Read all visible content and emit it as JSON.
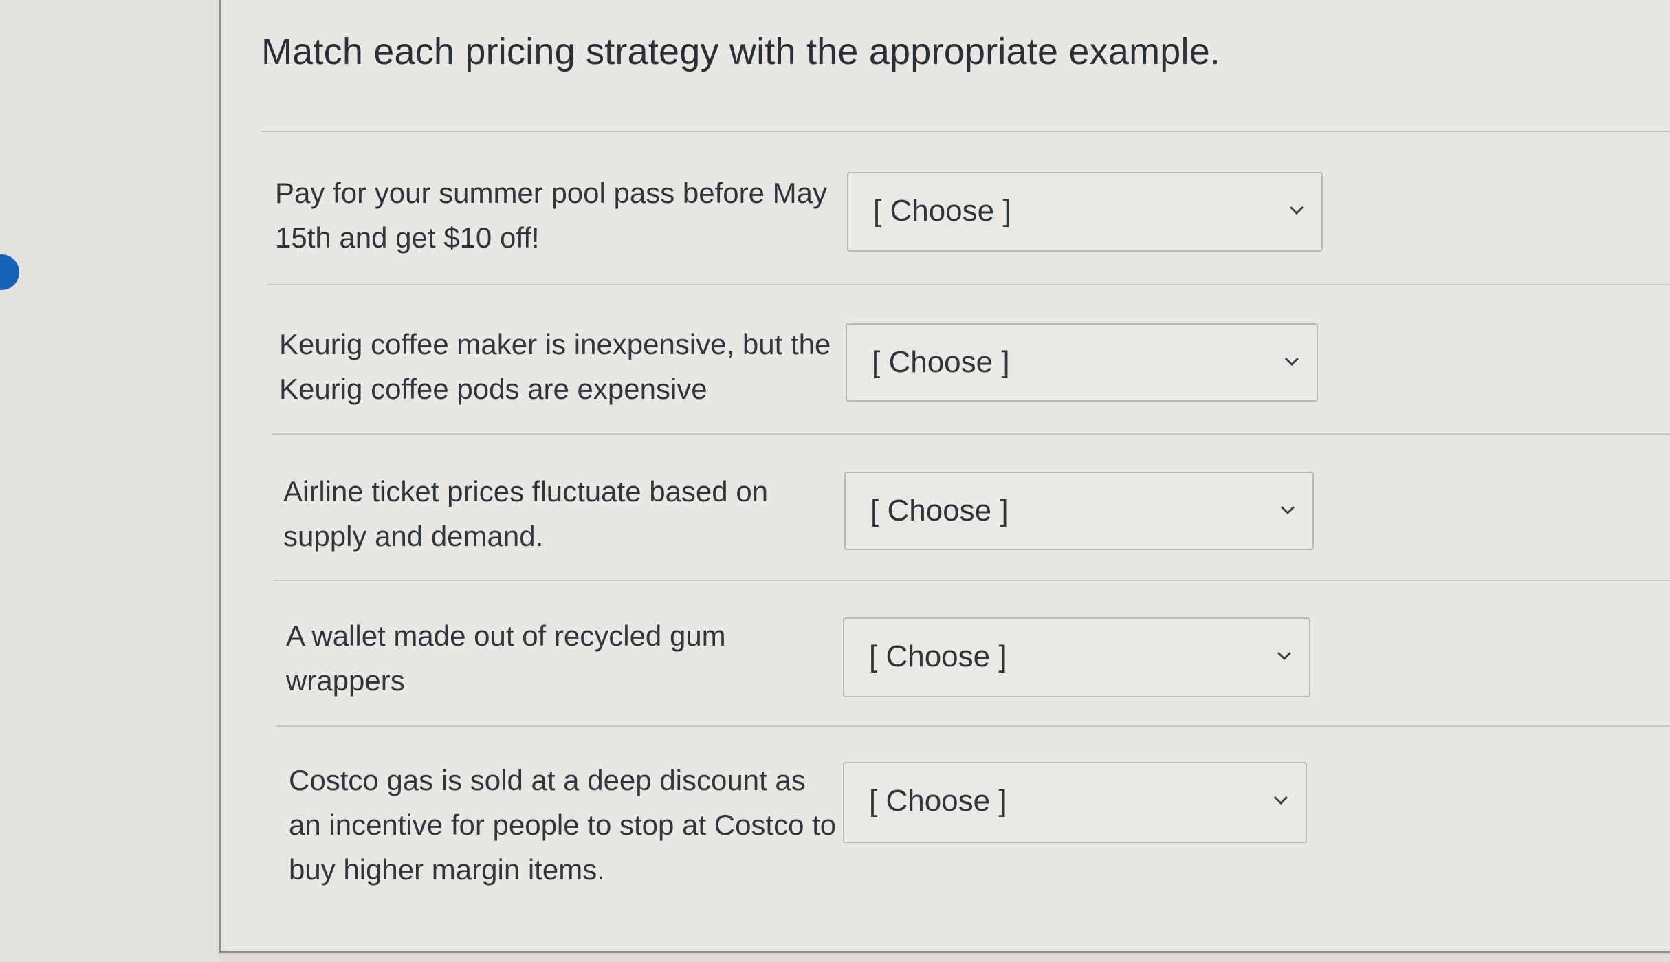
{
  "question": {
    "title": "Match each pricing strategy with the appropriate example."
  },
  "rows": [
    {
      "prompt": "Pay for your summer pool pass before May 15th and get $10 off!",
      "selected": "[ Choose ]"
    },
    {
      "prompt": "Keurig coffee maker is inexpensive, but the Keurig coffee pods are expensive",
      "selected": "[ Choose ]"
    },
    {
      "prompt": "Airline ticket prices fluctuate based on supply and demand.",
      "selected": "[ Choose ]"
    },
    {
      "prompt": "A wallet made out of recycled gum wrappers",
      "selected": "[ Choose ]"
    },
    {
      "prompt": "Costco gas is sold at a deep discount as an incentive for people to stop at Costco to buy higher margin items.",
      "selected": "[ Choose ]"
    }
  ],
  "icons": {
    "dropdown": "chevron-down-icon",
    "side_marker": "blue-dot"
  },
  "colors": {
    "side_marker": "#1763b5"
  }
}
